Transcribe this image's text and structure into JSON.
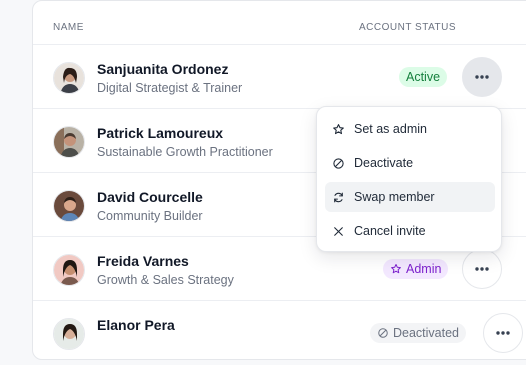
{
  "table": {
    "headers": {
      "name": "NAME",
      "status": "ACCOUNT STATUS"
    },
    "rows": [
      {
        "name": "Sanjuanita Ordonez",
        "role": "Digital Strategist & Trainer",
        "status": "Active"
      },
      {
        "name": "Patrick Lamoureux",
        "role": "Sustainable Growth Practitioner",
        "status": ""
      },
      {
        "name": "David Courcelle",
        "role": "Community Builder",
        "status": ""
      },
      {
        "name": "Freida Varnes",
        "role": "Growth & Sales Strategy",
        "status": "Admin"
      },
      {
        "name": "Elanor Pera",
        "role": "",
        "status": "Deactivated"
      }
    ]
  },
  "menu": {
    "items": [
      {
        "label": "Set as admin",
        "icon": "star-icon"
      },
      {
        "label": "Deactivate",
        "icon": "ban-icon"
      },
      {
        "label": "Swap member",
        "icon": "swap-icon"
      },
      {
        "label": "Cancel invite",
        "icon": "close-icon"
      }
    ]
  },
  "colors": {
    "active": "#15803d",
    "admin": "#7e22ce",
    "deactivated": "#6b7280"
  }
}
